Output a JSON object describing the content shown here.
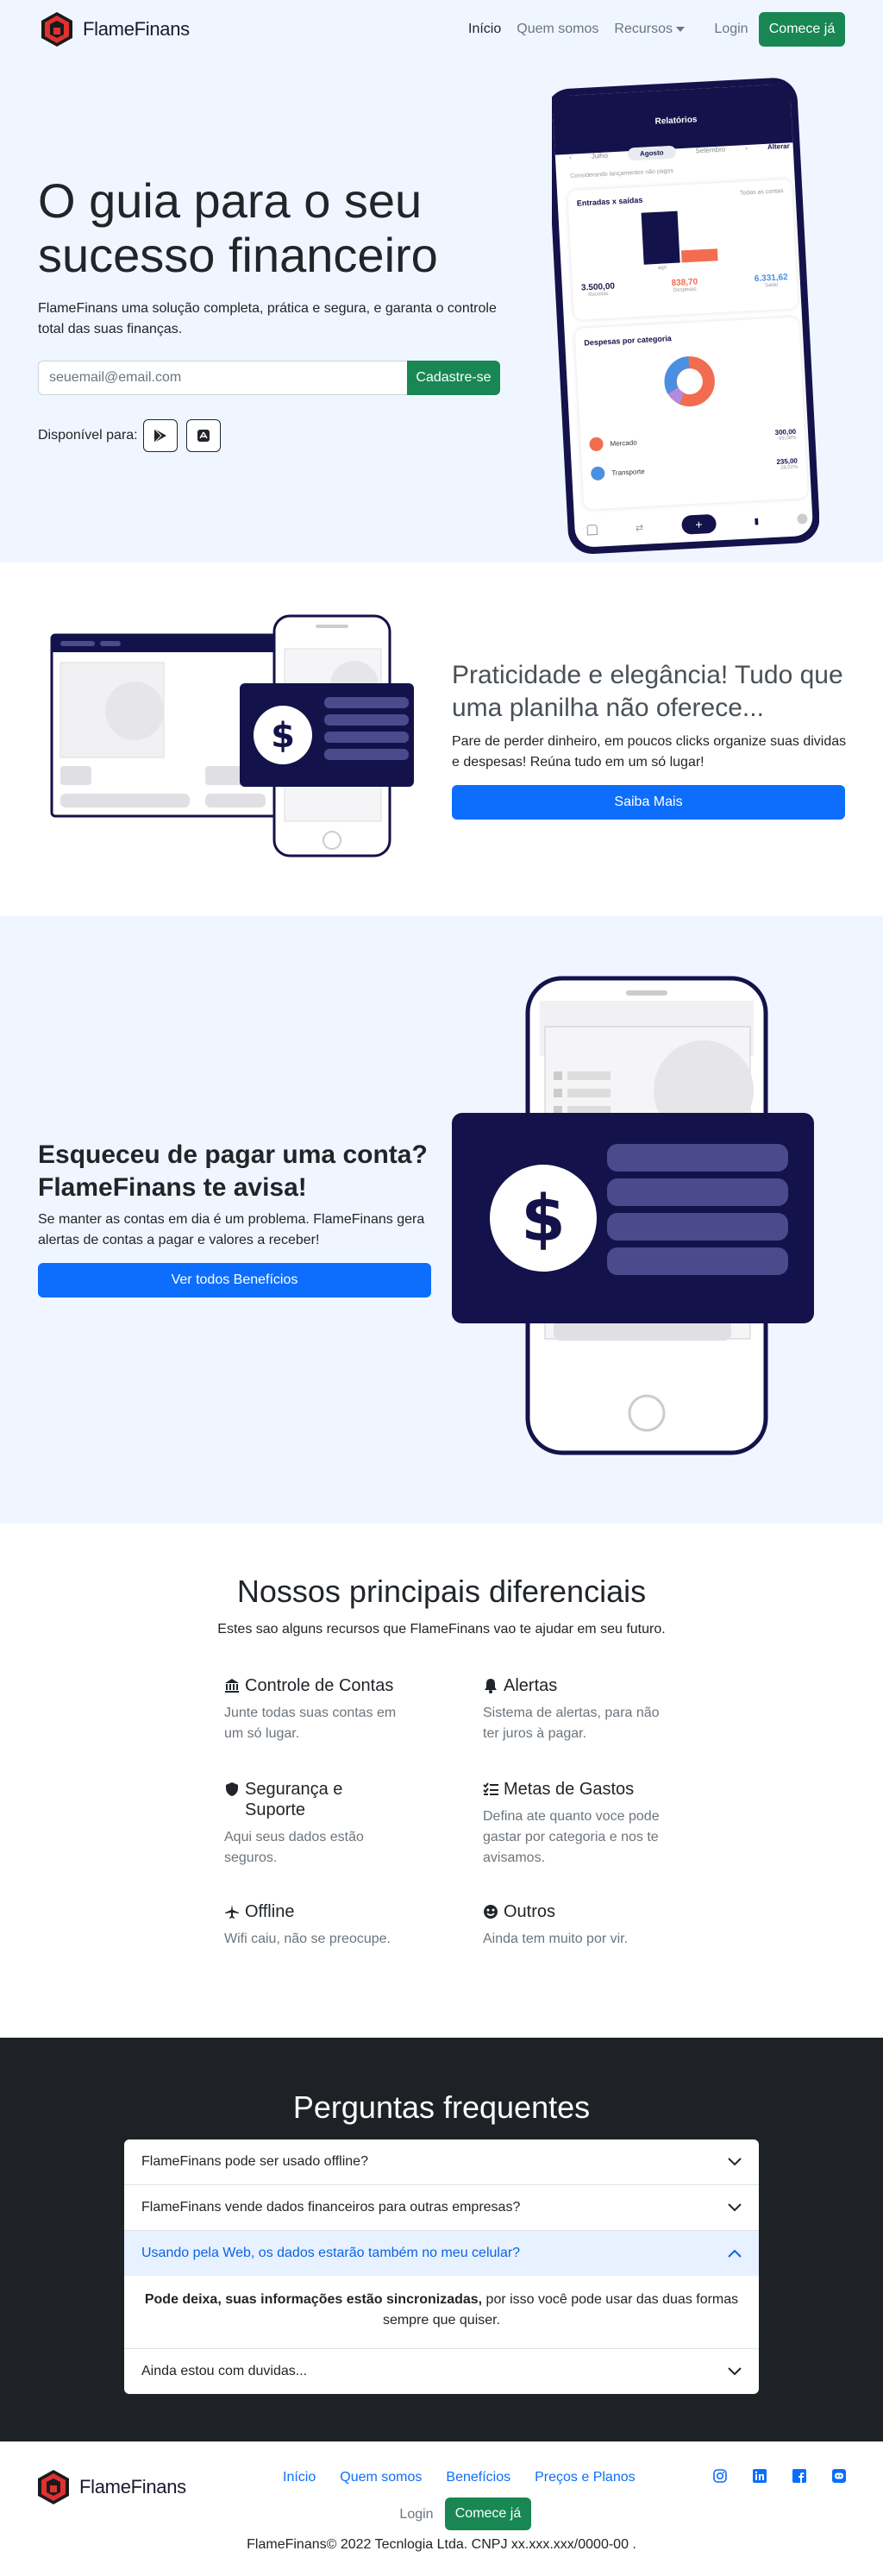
{
  "nav": {
    "brand": "FlameFinans",
    "links": [
      "Início",
      "Quem somos",
      "Recursos"
    ],
    "login": "Login",
    "cta": "Comece já"
  },
  "hero": {
    "title": "O guia para o seu sucesso financeiro",
    "subtitle": "FlameFinans uma solução completa, prática e segura, e garanta o controle total das suas finanças.",
    "email_placeholder": "seuemail@email.com",
    "signup": "Cadastre-se",
    "available": "Disponível para:",
    "phone": {
      "header": "Relatórios",
      "months": [
        "Julho",
        "Agosto",
        "Setembro"
      ],
      "filter": "Alterar",
      "hint": "Considerando lançamentos não pagos",
      "chart_title": "Entradas x saídas",
      "chart_filter": "Todas as contas",
      "stats": [
        {
          "value": "3.500,00",
          "label": "Receitas",
          "color": "#1a1a4a"
        },
        {
          "value": "838,70",
          "label": "Despesas",
          "color": "#f26c4f"
        },
        {
          "value": "6.331,62",
          "label": "Saldo",
          "color": "#4a90e2"
        }
      ],
      "bar_month": "ago",
      "category_title": "Despesas por categoria",
      "categories": [
        {
          "name": "Mercado",
          "value": "300,00",
          "pct": "69,08%",
          "color": "#f26c4f"
        },
        {
          "name": "Transporte",
          "value": "235,00",
          "pct": "28,02%",
          "color": "#4a90e2"
        }
      ]
    }
  },
  "feature1": {
    "title": "Praticidade e elegância! Tudo que uma planilha não oferece...",
    "text": "Pare de perder dinheiro, em poucos clicks organize suas dividas e despesas! Reúna tudo em um só lugar!",
    "button": "Saiba Mais"
  },
  "feature2": {
    "title": "Esqueceu de pagar uma conta? FlameFinans te avisa!",
    "text": "Se manter as contas em dia é um problema. FlameFinans gera alertas de contas a pagar e valores a receber!",
    "button": "Ver todos Benefícios"
  },
  "differentials": {
    "title": "Nossos principais diferenciais",
    "subtitle": "Estes sao alguns recursos que FlameFinans vao te ajudar em seu futuro.",
    "items": [
      {
        "icon": "bank-icon",
        "title": "Controle de Contas",
        "text": "Junte todas suas contas em um só lugar."
      },
      {
        "icon": "bell-icon",
        "title": "Alertas",
        "text": "Sistema de alertas, para não ter juros à pagar."
      },
      {
        "icon": "shield-icon",
        "title": "Segurança e Suporte",
        "text": "Aqui seus dados estão seguros."
      },
      {
        "icon": "list-check-icon",
        "title": "Metas de Gastos",
        "text": "Defina ate quanto voce pode gastar por categoria e nos te avisamos."
      },
      {
        "icon": "airplane-icon",
        "title": "Offline",
        "text": "Wifi caiu, não se preocupe."
      },
      {
        "icon": "smile-icon",
        "title": "Outros",
        "text": "Ainda tem muito por vir."
      }
    ]
  },
  "faq": {
    "title": "Perguntas frequentes",
    "items": [
      {
        "q": "FlameFinans pode ser usado offline?"
      },
      {
        "q": "FlameFinans vende dados financeiros para outras empresas?"
      },
      {
        "q": "Usando pela Web, os dados estarão também no meu celular?",
        "a_bold": "Pode deixa, suas informações estão sincronizadas,",
        "a_rest": " por isso você pode usar das duas formas sempre que quiser."
      },
      {
        "q": "Ainda estou com duvidas..."
      }
    ]
  },
  "footer": {
    "brand": "FlameFinans",
    "links": [
      "Início",
      "Quem somos",
      "Benefícios",
      "Preços e Planos"
    ],
    "login": "Login",
    "cta": "Comece já",
    "copyright": "FlameFinans© 2022 Tecnlogia Ltda. CNPJ xx.xxx.xxx/0000-00 ."
  },
  "colors": {
    "navy": "#14124a",
    "purple": "#4b4a8c",
    "green": "#198754",
    "blue": "#0d6efd",
    "light_bg": "#f0f6ff",
    "dark_bg": "#1e2227"
  }
}
